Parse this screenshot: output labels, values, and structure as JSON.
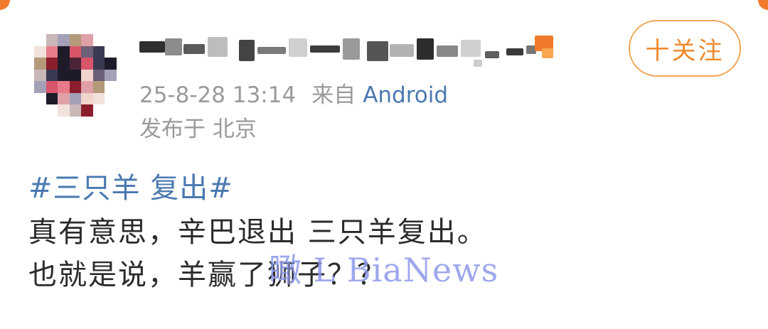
{
  "colors": {
    "accent_orange": "#f08a2c",
    "link_blue": "#4a79b0",
    "meta_gray": "#9a9a9a",
    "body_text": "#2b2b2b",
    "watermark": "#8c98ea"
  },
  "post": {
    "avatar_icon": "pixelated-avatar",
    "username_icon": "pixelated-username",
    "timestamp": "25-8-28 13:14",
    "source_prefix": "来自",
    "source_device": "Android",
    "location": "发布于 北京",
    "follow_label": "十关注",
    "hashtag": "#三只羊 复出#",
    "body_lines": [
      "真有意思，辛巴退出  三只羊复出。",
      "也就是说，羊赢了狮子？？"
    ],
    "watermark": "瞰 L BiaNews"
  }
}
